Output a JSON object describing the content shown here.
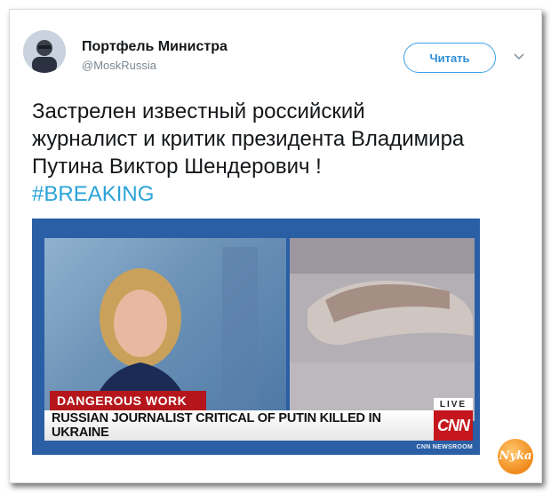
{
  "tweet": {
    "author_name": "Портфель Министра",
    "author_handle": "@MoskRussia",
    "follow_label": "Читать",
    "text_lines": [
      "Застрелен известный российский",
      "журналист и критик президента Владимира",
      "Путина Виктор Шендерович !"
    ],
    "hashtag": "#BREAKING"
  },
  "media": {
    "banner_label": "DANGEROUS WORK",
    "headline": "RUSSIAN JOURNALIST CRITICAL OF PUTIN KILLED IN UKRAINE",
    "live_label": "LIVE",
    "network_logo": "CNN",
    "network_subtitle": "CNN NEWSROOM"
  },
  "watermark": {
    "text": "Nyka"
  },
  "colors": {
    "follow_border": "#3aa0e8",
    "hashtag": "#2aa3d8",
    "cnn_red": "#c4161c",
    "media_blue": "#2a5fa6"
  }
}
